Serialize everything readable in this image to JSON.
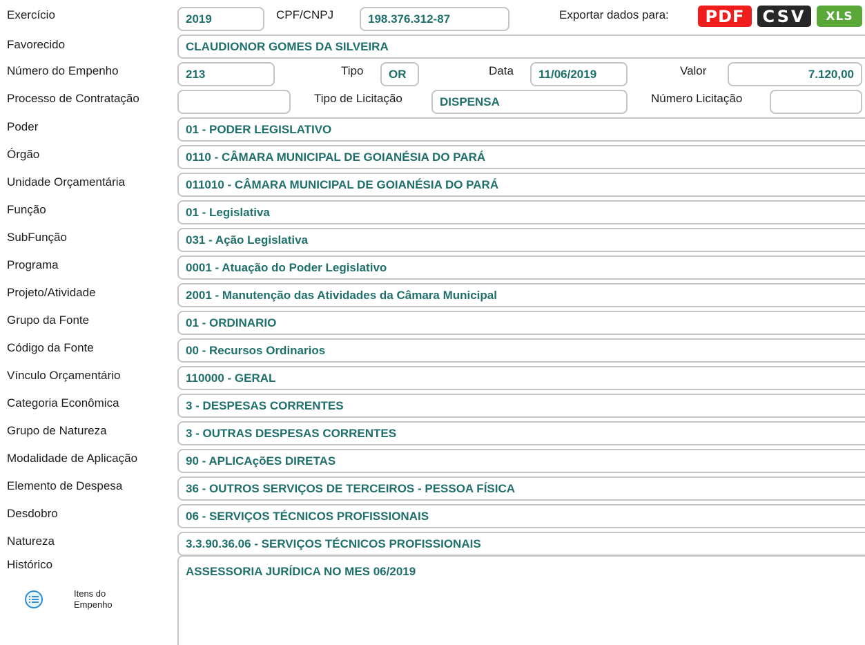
{
  "header": {
    "exercicio_label": "Exercício",
    "exercicio_value": "2019",
    "cpf_label": "CPF/CNPJ",
    "cpf_value": "198.376.312-87",
    "export_label": "Exportar dados para:",
    "export_pdf": "PDF",
    "export_csv": "CSV",
    "export_xls": "XLS"
  },
  "favorecido": {
    "label": "Favorecido",
    "value": "CLAUDIONOR GOMES DA SILVEIRA"
  },
  "empenho": {
    "numero_label": "Número do Empenho",
    "numero_value": "213",
    "tipo_label": "Tipo",
    "tipo_value": "OR",
    "data_label": "Data",
    "data_value": "11/06/2019",
    "valor_label": "Valor",
    "valor_value": "7.120,00"
  },
  "processo": {
    "label": "Processo de Contratação",
    "value": "",
    "tipo_licitacao_label": "Tipo de Licitação",
    "tipo_licitacao_value": "DISPENSA",
    "numero_licitacao_label": "Número Licitação",
    "numero_licitacao_value": ""
  },
  "rows": [
    {
      "label": "Poder",
      "value": "01 - PODER LEGISLATIVO"
    },
    {
      "label": "Órgão",
      "value": "0110 - CÂMARA MUNICIPAL DE GOIANÉSIA DO PARÁ"
    },
    {
      "label": "Unidade Orçamentária",
      "value": "011010 - CÂMARA MUNICIPAL DE GOIANÉSIA DO PARÁ"
    },
    {
      "label": "Função",
      "value": "01 - Legislativa"
    },
    {
      "label": "SubFunção",
      "value": "031 - Ação Legislativa"
    },
    {
      "label": "Programa",
      "value": "0001 - Atuação do Poder Legislativo"
    },
    {
      "label": "Projeto/Atividade",
      "value": "2001 - Manutenção das Atividades da Câmara Municipal"
    },
    {
      "label": "Grupo da Fonte",
      "value": "01 - ORDINARIO"
    },
    {
      "label": "Código da Fonte",
      "value": "00 - Recursos Ordinarios"
    },
    {
      "label": "Vínculo Orçamentário",
      "value": "110000 - GERAL"
    },
    {
      "label": "Categoria Econômica",
      "value": "3 - DESPESAS CORRENTES"
    },
    {
      "label": "Grupo de Natureza",
      "value": "3 - OUTRAS DESPESAS CORRENTES"
    },
    {
      "label": "Modalidade de Aplicação",
      "value": "90 - APLICAçõES DIRETAS"
    },
    {
      "label": "Elemento de Despesa",
      "value": "36 - OUTROS SERVIÇOS DE TERCEIROS - PESSOA FÍSICA"
    },
    {
      "label": "Desdobro",
      "value": "06 - SERVIÇOS TÉCNICOS PROFISSIONAIS"
    },
    {
      "label": "Natureza",
      "value": "3.3.90.36.06 - SERVIÇOS TÉCNICOS PROFISSIONAIS"
    }
  ],
  "historico": {
    "label": "Histórico",
    "value": "ASSESSORIA JURÍDICA NO MES 06/2019"
  },
  "itens": {
    "label_line1": "Itens do",
    "label_line2": "Empenho",
    "icon": "list-icon"
  },
  "colors": {
    "value_text": "#1f6f6c",
    "border": "#c4c4c4",
    "pdf": "#f01d1d",
    "csv": "#272727",
    "xls": "#5aa838",
    "icon": "#2f8fd6"
  }
}
